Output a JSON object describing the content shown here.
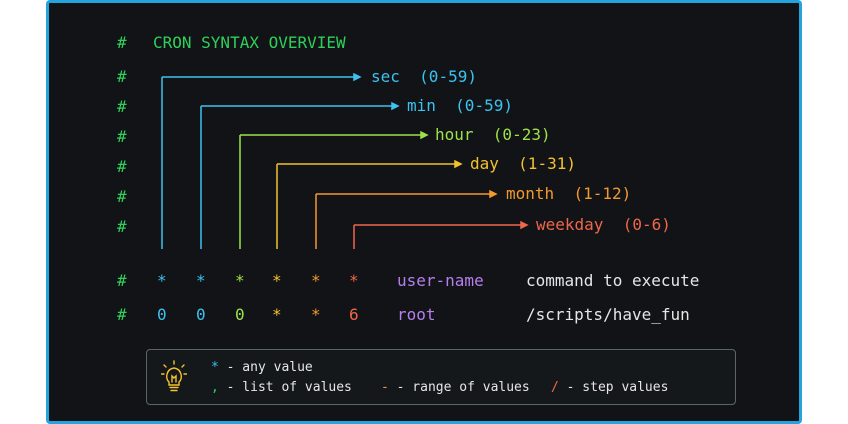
{
  "title": "CRON SYNTAX OVERVIEW",
  "comment_marker": "#",
  "fields": [
    {
      "name": "sec",
      "range": "(0-59)",
      "color": "#3cc2ef"
    },
    {
      "name": "min",
      "range": "(0-59)",
      "color": "#3cc2ef"
    },
    {
      "name": "hour",
      "range": "(0-23)",
      "color": "#9ee24a"
    },
    {
      "name": "day",
      "range": "(1-31)",
      "color": "#f3c22e"
    },
    {
      "name": "month",
      "range": "(1-12)",
      "color": "#f39a2e"
    },
    {
      "name": "weekday",
      "range": "(0-6)",
      "color": "#f0664a"
    }
  ],
  "pattern_row": {
    "values": [
      "*",
      "*",
      "*",
      "*",
      "*",
      "*"
    ],
    "user": "user-name",
    "command": "command to execute"
  },
  "example_row": {
    "values": [
      "0",
      "0",
      "0",
      "*",
      "*",
      "6"
    ],
    "user": "root",
    "command": "/scripts/have_fun"
  },
  "legend": {
    "icon": "lightbulb-icon",
    "any_symbol": "*",
    "any_text": " - any value",
    "list_symbol": ",",
    "list_text": " - list of values",
    "range_symbol": "-",
    "range_text": " - range of values",
    "step_symbol": "/",
    "step_text": " - step values"
  },
  "colors": {
    "background": "#111316",
    "border": "#25a3dd",
    "hash": "#2fd05a",
    "title": "#2fd05a",
    "user": "#b77ef0",
    "text": "#e6e6e6"
  }
}
